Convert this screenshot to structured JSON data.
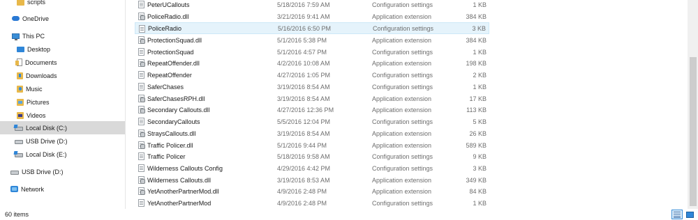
{
  "nav": {
    "items": [
      {
        "label": "scripts",
        "icon": "folder-icon"
      },
      {
        "label": "OneDrive",
        "icon": "onedrive-icon"
      },
      {
        "label": "This PC",
        "icon": "computer-icon"
      },
      {
        "label": "Desktop",
        "icon": "desktop-icon"
      },
      {
        "label": "Documents",
        "icon": "documents-icon"
      },
      {
        "label": "Downloads",
        "icon": "downloads-icon"
      },
      {
        "label": "Music",
        "icon": "music-icon"
      },
      {
        "label": "Pictures",
        "icon": "pictures-icon"
      },
      {
        "label": "Videos",
        "icon": "videos-icon"
      },
      {
        "label": "Local Disk (C:)",
        "icon": "local-disk-icon",
        "selected": true
      },
      {
        "label": "USB Drive (D:)",
        "icon": "usb-drive-icon"
      },
      {
        "label": "Local Disk (E:)",
        "icon": "local-disk-icon"
      },
      {
        "label": "USB Drive (D:)",
        "icon": "usb-drive-icon"
      },
      {
        "label": "Network",
        "icon": "network-icon"
      }
    ]
  },
  "files": [
    {
      "name": "PeterUCallouts",
      "date": "5/18/2016 7:59 AM",
      "type": "Configuration settings",
      "size": "1 KB",
      "icon": "config-file-icon"
    },
    {
      "name": "PoliceRadio.dll",
      "date": "3/21/2016 9:41 AM",
      "type": "Application extension",
      "size": "384 KB",
      "icon": "dll-file-icon"
    },
    {
      "name": "PoliceRadio",
      "date": "5/16/2016 6:50 PM",
      "type": "Configuration settings",
      "size": "3 KB",
      "icon": "config-file-icon",
      "selected": true
    },
    {
      "name": "ProtectionSquad.dll",
      "date": "5/1/2016 5:38 PM",
      "type": "Application extension",
      "size": "384 KB",
      "icon": "dll-file-icon"
    },
    {
      "name": "ProtectionSquad",
      "date": "5/1/2016 4:57 PM",
      "type": "Configuration settings",
      "size": "1 KB",
      "icon": "config-file-icon"
    },
    {
      "name": "RepeatOffender.dll",
      "date": "4/2/2016 10:08 AM",
      "type": "Application extension",
      "size": "198 KB",
      "icon": "dll-file-icon"
    },
    {
      "name": "RepeatOffender",
      "date": "4/27/2016 1:05 PM",
      "type": "Configuration settings",
      "size": "2 KB",
      "icon": "config-file-icon"
    },
    {
      "name": "SaferChases",
      "date": "3/19/2016 8:54 AM",
      "type": "Configuration settings",
      "size": "1 KB",
      "icon": "config-file-icon"
    },
    {
      "name": "SaferChasesRPH.dll",
      "date": "3/19/2016 8:54 AM",
      "type": "Application extension",
      "size": "17 KB",
      "icon": "dll-file-icon"
    },
    {
      "name": "Secondary Callouts.dll",
      "date": "4/27/2016 12:36 PM",
      "type": "Application extension",
      "size": "113 KB",
      "icon": "dll-file-icon"
    },
    {
      "name": "SecondaryCallouts",
      "date": "5/5/2016 12:04 PM",
      "type": "Configuration settings",
      "size": "5 KB",
      "icon": "config-file-icon"
    },
    {
      "name": "StraysCallouts.dll",
      "date": "3/19/2016 8:54 AM",
      "type": "Application extension",
      "size": "26 KB",
      "icon": "dll-file-icon"
    },
    {
      "name": "Traffic Policer.dll",
      "date": "5/1/2016 9:44 PM",
      "type": "Application extension",
      "size": "589 KB",
      "icon": "dll-file-icon"
    },
    {
      "name": "Traffic Policer",
      "date": "5/18/2016 9:58 AM",
      "type": "Configuration settings",
      "size": "9 KB",
      "icon": "config-file-icon"
    },
    {
      "name": "Wilderness Callouts Config",
      "date": "4/29/2016 4:42 PM",
      "type": "Configuration settings",
      "size": "3 KB",
      "icon": "config-file-icon"
    },
    {
      "name": "Wilderness Callouts.dll",
      "date": "3/19/2016 8:53 AM",
      "type": "Application extension",
      "size": "349 KB",
      "icon": "dll-file-icon"
    },
    {
      "name": "YetAnotherPartnerMod.dll",
      "date": "4/9/2016 2:48 PM",
      "type": "Application extension",
      "size": "84 KB",
      "icon": "dll-file-icon"
    },
    {
      "name": "YetAnotherPartnerMod",
      "date": "4/9/2016 2:48 PM",
      "type": "Configuration settings",
      "size": "1 KB",
      "icon": "config-file-icon"
    }
  ],
  "status": {
    "item_count": "60 items"
  },
  "colors": {
    "selected_row_bg": "#e5f3fb",
    "selected_nav_bg": "#d9d9d9",
    "accent": "#3c8fd9"
  }
}
